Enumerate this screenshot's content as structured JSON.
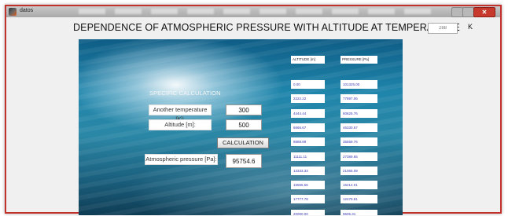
{
  "window": {
    "title": "datos"
  },
  "header": {
    "heading": "DEPENDENCE OF ATMOSPHERIC PRESSURE WITH ALTITUDE AT TEMPERATURE",
    "temperature_value": "288",
    "temperature_unit": "K"
  },
  "calculation": {
    "title": "SPECIFIC CALCULATION",
    "temp_label": "Another temperature [K]:",
    "temp_value": "300",
    "altitude_label": "Altitude [m]:",
    "altitude_value": "500",
    "button_label": "CALCULATION",
    "pressure_label": "Atmospheric pressure [Pa]:",
    "pressure_value": "95754.6"
  },
  "table": {
    "altitude_header": "ALTITUDE [m]",
    "pressure_header": "PRESSURE [Pa]",
    "altitudes": [
      "0.00",
      "2222.22",
      "4444.44",
      "6666.67",
      "8888.89",
      "11111.11",
      "13333.33",
      "15555.56",
      "17777.78",
      "20000.00"
    ],
    "pressures": [
      "101325.00",
      "77897.06",
      "60625.76",
      "46330.67",
      "35559.76",
      "27389.65",
      "21065.09",
      "16214.01",
      "12479.81",
      "9605.31"
    ]
  },
  "colors": {
    "frame": "#c2322b",
    "table_text": "#3a3ab8"
  }
}
